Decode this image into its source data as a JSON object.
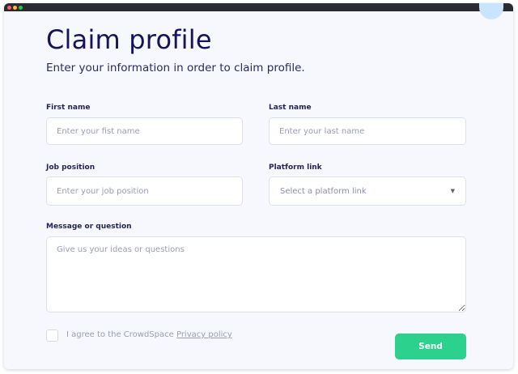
{
  "form": {
    "title": "Claim profile",
    "subtitle": "Enter your information in order to claim profile.",
    "first_name": {
      "label": "First name",
      "placeholder": "Enter your fist name",
      "value": ""
    },
    "last_name": {
      "label": "Last name",
      "placeholder": "Enter your last name",
      "value": ""
    },
    "job_position": {
      "label": "Job position",
      "placeholder": "Enter your job position",
      "value": ""
    },
    "platform_link": {
      "label": "Platform link",
      "selected": "Select a platform link"
    },
    "message": {
      "label": "Message or question",
      "placeholder": "Give us your ideas or questions",
      "value": ""
    },
    "agree": {
      "text": "I agree to the CrowdSpace ",
      "link": "Privacy policy",
      "checked": false
    },
    "send_label": "Send"
  },
  "colors": {
    "title": "#14145a",
    "accent": "#2bd18c",
    "background": "#f7f8fd",
    "border": "#dcdff0"
  },
  "icons": {
    "select_caret": "caret-down-icon"
  }
}
